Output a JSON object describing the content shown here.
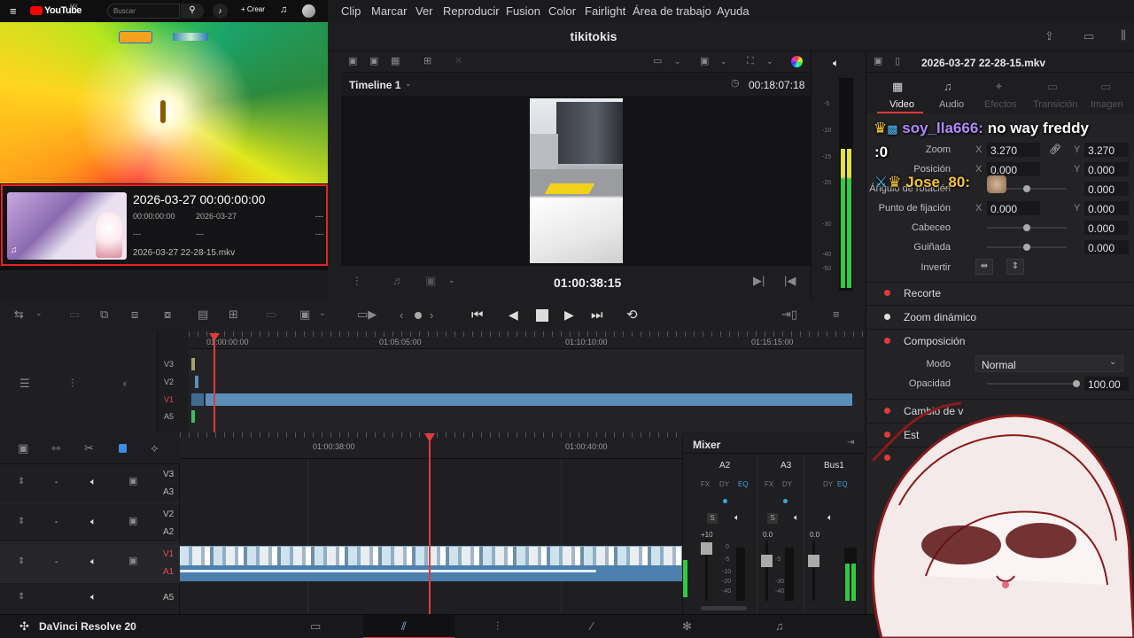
{
  "menu": {
    "items": [
      "Clip",
      "Marcar",
      "Ver",
      "Reproducir",
      "Fusion",
      "Color",
      "Fairlight",
      "Área de trabajo",
      "Ayuda"
    ]
  },
  "project": {
    "title": "tikitokis"
  },
  "youtube": {
    "logo": "YouTube",
    "region": "MX",
    "search_placeholder": "Buscar",
    "create_label": "Crear",
    "card": {
      "title": "2026-03-27  00:00:00:00",
      "meta1": "00:00:00:00",
      "meta2": "2026-03-27",
      "dash1": "---",
      "dash2": "---",
      "dash3": "---",
      "dash4": "---",
      "filename": "2026-03-27 22-28-15.mkv"
    }
  },
  "viewer": {
    "timeline_name": "Timeline 1",
    "duration": "00:18:07:18",
    "timecode": "01:00:38:15"
  },
  "timeline": {
    "ruler_upper": [
      "01:00:00:00",
      "01:05:05:00",
      "01:10:10:00",
      "01:15:15:00"
    ],
    "tracks_upper": [
      "V3",
      "V2",
      "V1",
      "A5"
    ],
    "ruler_lower": [
      "01:00:38:00",
      "01:00:40:00"
    ],
    "tracks_lower": [
      {
        "v": "V3",
        "a": "A3"
      },
      {
        "v": "V2",
        "a": "A2"
      },
      {
        "v": "V1",
        "a": "A1"
      },
      {
        "v": "",
        "a": "A5"
      }
    ]
  },
  "mixer": {
    "title": "Mixer",
    "channels": [
      "A2",
      "A3",
      "Bus1"
    ],
    "fx": [
      "FX",
      "DY",
      "EQ"
    ],
    "solo": "S",
    "gain1": "+10",
    "gain2": "0.0",
    "gain3": "0.0",
    "scale": [
      "0",
      "-5",
      "-10",
      "-20",
      "-30",
      "-40"
    ]
  },
  "meter_scale": [
    "-5",
    "-10",
    "-15",
    "-20",
    "-30",
    "-40",
    "-50"
  ],
  "inspector": {
    "filename": "2026-03-27 22-28-15.mkv",
    "tabs": [
      {
        "label": "Video",
        "active": true
      },
      {
        "label": "Audio"
      },
      {
        "label": "Efectos"
      },
      {
        "label": "Transición"
      },
      {
        "label": "Imagen"
      }
    ],
    "zoom": {
      "label": "Zoom",
      "x": "3.270",
      "y": "3.270"
    },
    "posicion": {
      "label": "Posición",
      "x": "0.000",
      "y": "0.000"
    },
    "angulo": {
      "label": "Ángulo de rotación",
      "v": "0.000"
    },
    "fijacion": {
      "label": "Punto de fijación",
      "x": "0.000",
      "y": "0.000"
    },
    "cabeceo": {
      "label": "Cabeceo",
      "v": "0.000"
    },
    "guinada": {
      "label": "Guiñada",
      "v": "0.000"
    },
    "invertir": {
      "label": "Invertir"
    },
    "sections": [
      "Recorte",
      "Zoom dinámico",
      "Composición"
    ],
    "modo": {
      "label": "Modo",
      "value": "Normal"
    },
    "opacidad": {
      "label": "Opacidad",
      "value": "100.00"
    },
    "more_sections": [
      "Cambio de v",
      "Est"
    ],
    "axis_x": "X",
    "axis_y": "Y"
  },
  "chat": [
    {
      "user": "soy_lla666:",
      "msg": "no way freddy",
      ":0": ":0",
      "cont": ":0"
    },
    {
      "user": "Jose_80:"
    }
  ],
  "brand": {
    "label": "DaVinci Resolve 20"
  },
  "colors": {
    "accent": "#e03a3a",
    "clip": "#5b8fb9",
    "meter": "#2ecc40"
  }
}
